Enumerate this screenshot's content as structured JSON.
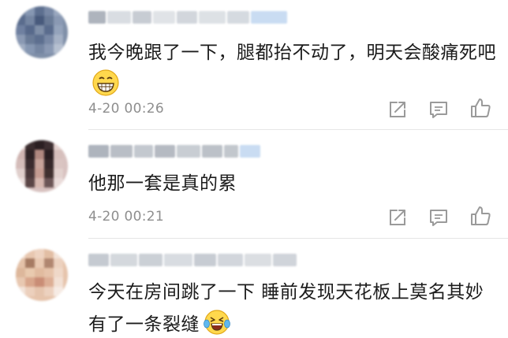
{
  "comments": [
    {
      "text": "我今晚跟了一下，腿都抬不动了，明天会酸痛死吧",
      "emoji": "grinning-face-emoji",
      "timestamp": "4-20 00:26",
      "avatar": "blurred-avatar",
      "username": "blurred-username"
    },
    {
      "text": "他那一套是真的累",
      "timestamp": "4-20 00:21",
      "avatar": "blurred-avatar",
      "username": "blurred-username"
    },
    {
      "text": "今天在房间跳了一下 睡前发现天花板上莫名其妙有了一条裂缝",
      "emoji": "laughing-tears-emoji",
      "avatar": "blurred-avatar",
      "username": "blurred-username"
    }
  ],
  "icons": {
    "share": "share-icon",
    "reply": "reply-icon",
    "like": "like-icon"
  },
  "colors": {
    "text": "#1c1c1c",
    "meta": "#8e8e8e",
    "icon": "#9a9a9a",
    "divider": "#e6e6e6",
    "username_tint": "#c9dcf2"
  }
}
